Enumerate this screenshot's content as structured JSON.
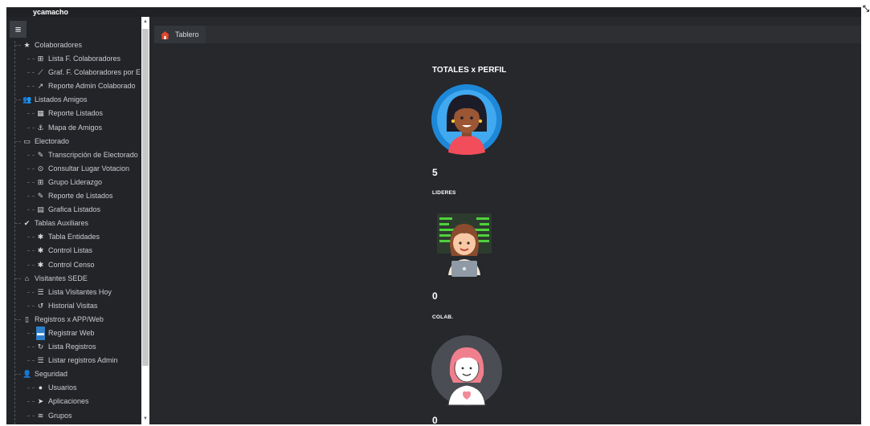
{
  "user": {
    "name": "ycamacho"
  },
  "sidebar": {
    "items": [
      {
        "label": "Colaboradores",
        "icon": "star-icon",
        "level": 1
      },
      {
        "label": "Lista F. Colaboradores",
        "icon": "sitemap-icon",
        "level": 2
      },
      {
        "label": "Graf. F. Colaboradores por E",
        "icon": "line-chart-icon",
        "level": 2
      },
      {
        "label": "Reporte Admin Colaborado",
        "icon": "arrow-icon",
        "level": 2
      },
      {
        "label": "Listados Amigos",
        "icon": "users-icon",
        "level": 1
      },
      {
        "label": "Reporte Listados",
        "icon": "table-icon",
        "level": 2
      },
      {
        "label": "Mapa de Amigos",
        "icon": "anchor-icon",
        "level": 2
      },
      {
        "label": "Electorado",
        "icon": "ballot-icon",
        "level": 1
      },
      {
        "label": "Transcripción de Electorado",
        "icon": "edit-icon",
        "level": 2
      },
      {
        "label": "Consultar Lugar Votacion",
        "icon": "location-icon",
        "level": 2
      },
      {
        "label": "Grupo Liderazgo",
        "icon": "sitemap-icon",
        "level": 2
      },
      {
        "label": "Reporte de Listados",
        "icon": "edit-icon",
        "level": 2
      },
      {
        "label": "Grafica Listados",
        "icon": "chart-icon",
        "level": 2
      },
      {
        "label": "Tablas Auxiliares",
        "icon": "check-circle-icon",
        "level": 1
      },
      {
        "label": "Tabla Entidades",
        "icon": "gear-icon",
        "level": 2
      },
      {
        "label": "Control Listas",
        "icon": "gear-icon",
        "level": 2
      },
      {
        "label": "Control Censo",
        "icon": "gear-icon",
        "level": 2
      },
      {
        "label": "Visitantes SEDE",
        "icon": "building-icon",
        "level": 1
      },
      {
        "label": "Lista Visitantes Hoy",
        "icon": "list-icon",
        "level": 2
      },
      {
        "label": "Historial Visitas",
        "icon": "history-icon",
        "level": 2
      },
      {
        "label": "Registros x APP/Web",
        "icon": "mobile-icon",
        "level": 1
      },
      {
        "label": "Registrar Web",
        "icon": "form-icon",
        "level": 2,
        "active": true
      },
      {
        "label": "Lista Registros",
        "icon": "refresh-icon",
        "level": 2
      },
      {
        "label": "Listar registros Admin",
        "icon": "list-icon",
        "level": 2
      },
      {
        "label": "Seguridad",
        "icon": "users-lock-icon",
        "level": 1
      },
      {
        "label": "Usuarios",
        "icon": "user-icon",
        "level": 2
      },
      {
        "label": "Aplicaciones",
        "icon": "rocket-icon",
        "level": 2
      },
      {
        "label": "Grupos",
        "icon": "database-icon",
        "level": 2
      }
    ]
  },
  "breadcrumb": {
    "label": "Tablero",
    "icon": "home-icon"
  },
  "dashboard": {
    "title": "TOTALES x PERFIL",
    "profiles": [
      {
        "count": "5",
        "role": "LIDERES",
        "avatar": "leader-avatar-icon"
      },
      {
        "count": "0",
        "role": "COLAB.",
        "avatar": "collaborator-avatar-icon"
      },
      {
        "count": "0",
        "role": "",
        "avatar": "user-avatar-icon"
      }
    ]
  },
  "colors": {
    "active": "#2f80c9",
    "sidebar": "#222428",
    "main": "#26282c",
    "home": "#e8452c"
  }
}
